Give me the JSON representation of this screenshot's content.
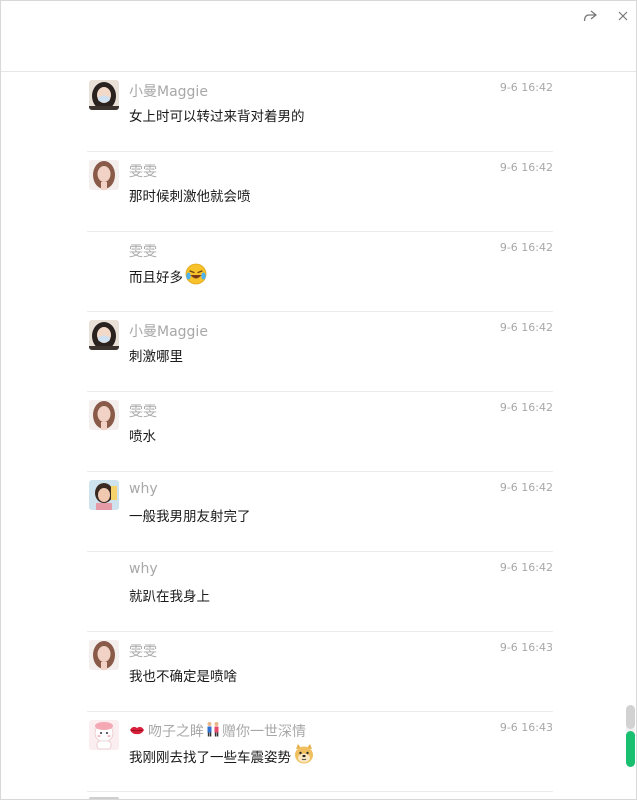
{
  "toolbar": {
    "share_icon": "share-icon",
    "close_icon": "close-icon"
  },
  "colors": {
    "accent": "#18c070",
    "sender": "#a8a8a8",
    "text": "#1a1a1a",
    "divider": "#ececec"
  },
  "messages": [
    {
      "sender": "小曼Maggie",
      "time": "9-6 16:42",
      "text": "女上时可以转过来背对着男的",
      "avatar": "avatar-maggie"
    },
    {
      "sender": "雯雯",
      "time": "9-6 16:42",
      "text": "那时候刺激他就会喷",
      "avatar": "avatar-wenwen"
    },
    {
      "sender": "雯雯",
      "time": "9-6 16:42",
      "text": "而且好多",
      "emoji": "laughing-crying-emoji"
    },
    {
      "sender": "小曼Maggie",
      "time": "9-6 16:42",
      "text": "刺激哪里",
      "avatar": "avatar-maggie"
    },
    {
      "sender": "雯雯",
      "time": "9-6 16:42",
      "text": "喷水",
      "avatar": "avatar-wenwen"
    },
    {
      "sender": "why",
      "time": "9-6 16:42",
      "text": "一般我男朋友射完了",
      "avatar": "avatar-why"
    },
    {
      "sender": "why",
      "time": "9-6 16:42",
      "text": "就趴在我身上"
    },
    {
      "sender": "雯雯",
      "time": "9-6 16:43",
      "text": "我也不确定是喷啥",
      "avatar": "avatar-wenwen"
    },
    {
      "sender": "吻子之眸赠你一世深情",
      "sender_prefix_icon": "lips-icon",
      "sender_mid_icon": "couple-icon",
      "sender_part1": "吻子之眸",
      "sender_part2": "赠你一世深情",
      "time": "9-6 16:43",
      "text": "我刚刚去找了一些车震姿势",
      "emoji": "doge-emoji",
      "avatar": "avatar-wenzi"
    }
  ]
}
